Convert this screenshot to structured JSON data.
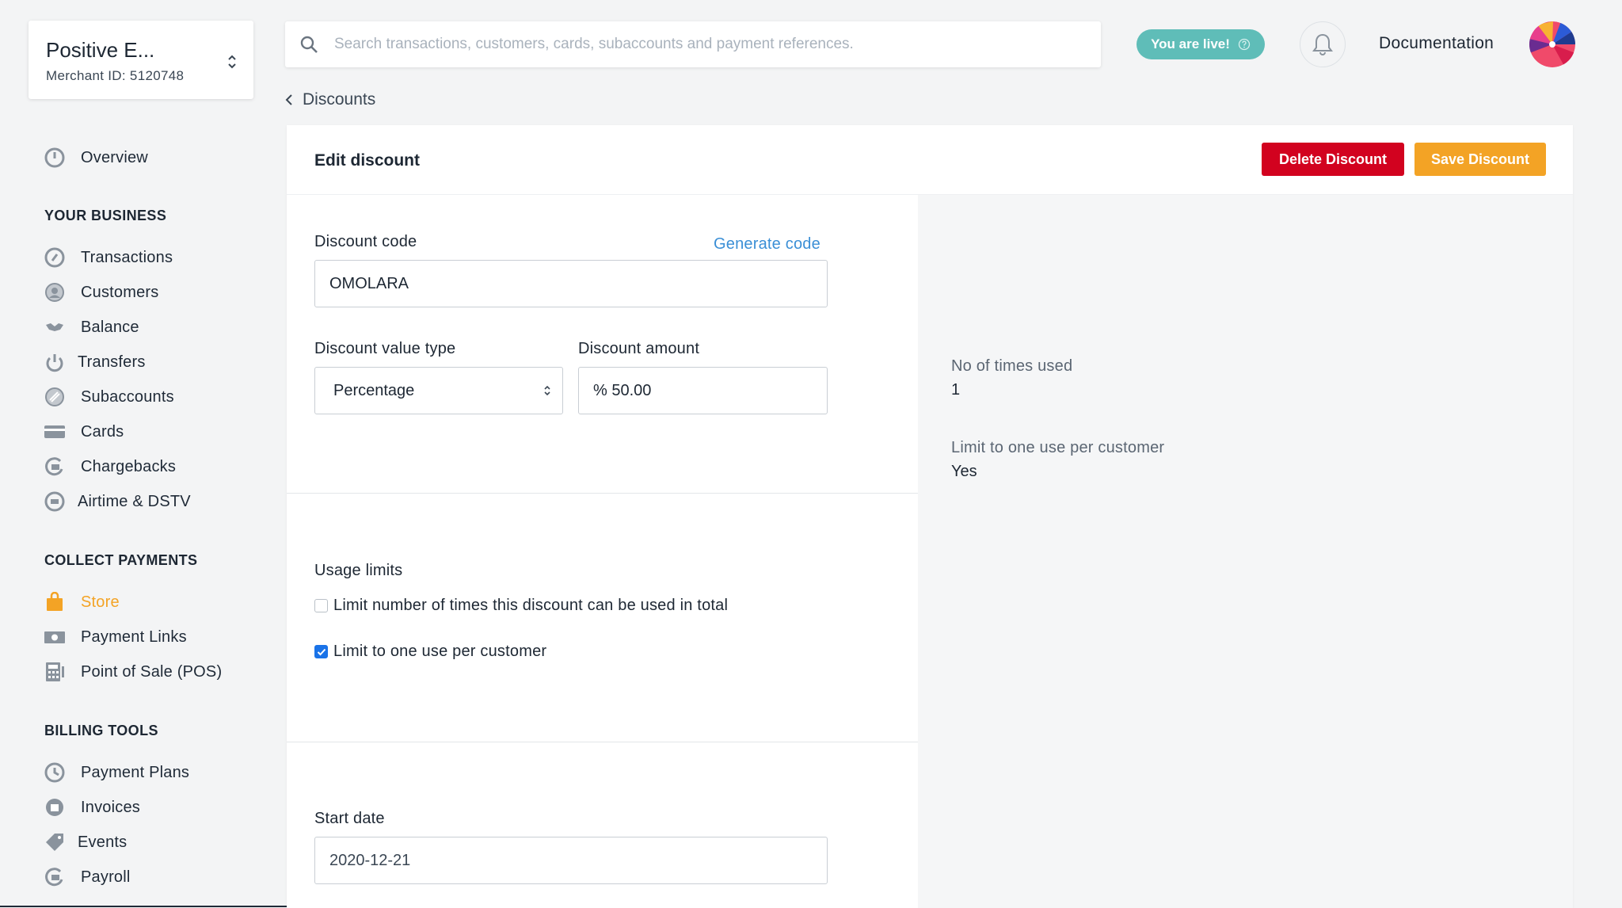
{
  "merchant": {
    "name": "Positive E...",
    "id_text": "Merchant ID: 5120748"
  },
  "sidebar": {
    "overview": "Overview",
    "sections": [
      {
        "title": "YOUR BUSINESS",
        "items": [
          "Transactions",
          "Customers",
          "Balance",
          "Transfers",
          "Subaccounts",
          "Cards",
          "Chargebacks",
          "Airtime & DSTV"
        ]
      },
      {
        "title": "COLLECT PAYMENTS",
        "items": [
          "Store",
          "Payment Links",
          "Point of Sale (POS)"
        ]
      },
      {
        "title": "BILLING TOOLS",
        "items": [
          "Payment Plans",
          "Invoices",
          "Events",
          "Payroll"
        ]
      }
    ],
    "active_item": "Store",
    "accent_color": "#f3a325"
  },
  "topbar": {
    "search_placeholder": "Search transactions, customers, cards, subaccounts and payment references.",
    "live_badge": "You are live!",
    "docs_link": "Documentation"
  },
  "breadcrumb": {
    "back_label": "Discounts"
  },
  "page": {
    "title": "Edit discount",
    "delete_button": "Delete Discount",
    "save_button": "Save Discount",
    "delete_color": "#d2021f",
    "save_color": "#f3a325"
  },
  "form": {
    "discount_code_label": "Discount code",
    "generate_code_link": "Generate code",
    "discount_code_value": "OMOLARA",
    "value_type_label": "Discount value type",
    "value_type_selected": "Percentage",
    "amount_label": "Discount amount",
    "amount_value": "% 50.00",
    "usage_limits_label": "Usage limits",
    "limit_total_label": "Limit number of times this discount can be used in total",
    "limit_total_checked": false,
    "limit_per_customer_label": "Limit to one use per customer",
    "limit_per_customer_checked": true,
    "start_date_label": "Start date",
    "start_date_value": "2020-12-21"
  },
  "summary": {
    "times_used_label": "No of times used",
    "times_used_value": "1",
    "one_use_label": "Limit to one use per customer",
    "one_use_value": "Yes"
  }
}
